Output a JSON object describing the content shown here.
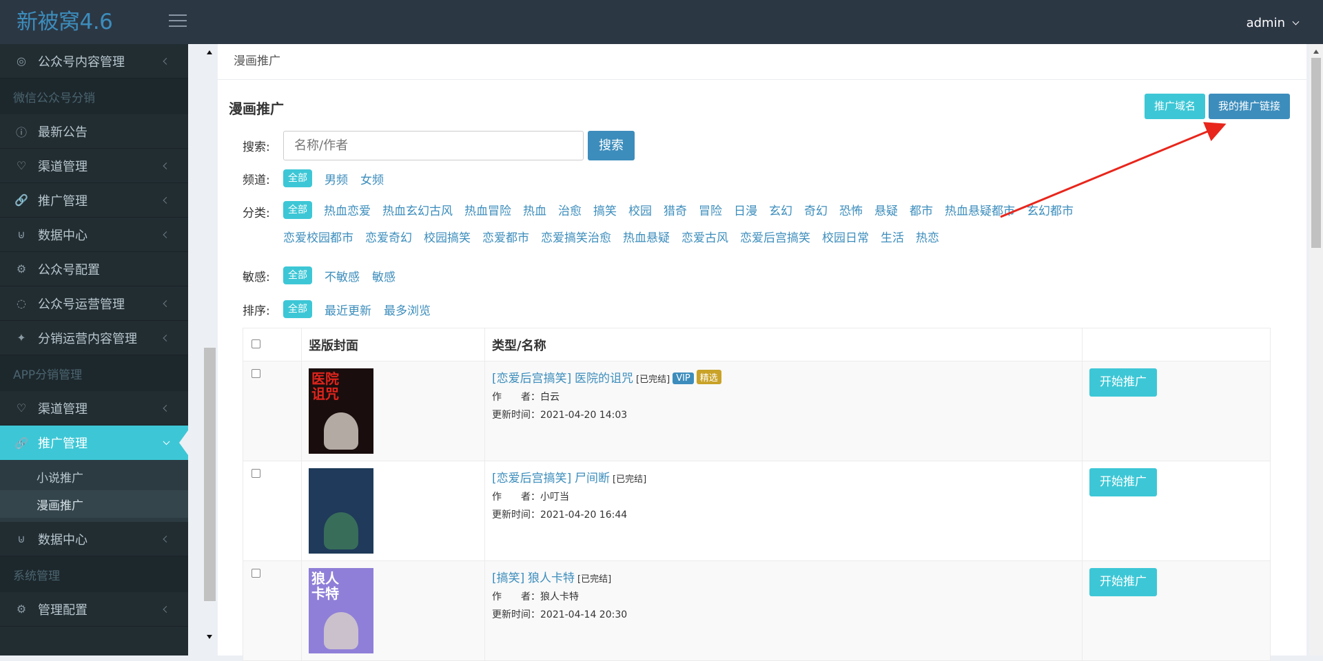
{
  "app": {
    "logo": "新被窝4.6",
    "user": "admin"
  },
  "sidebar": {
    "items": [
      {
        "label": "公众号内容管理",
        "icon": "compass-icon",
        "type": "item"
      },
      {
        "label": "微信公众号分销",
        "type": "header"
      },
      {
        "label": "最新公告",
        "icon": "info-icon",
        "type": "item"
      },
      {
        "label": "渠道管理",
        "icon": "lightbulb-icon",
        "type": "item"
      },
      {
        "label": "推广管理",
        "icon": "link-icon",
        "type": "item"
      },
      {
        "label": "数据中心",
        "icon": "cart-icon",
        "type": "item"
      },
      {
        "label": "公众号配置",
        "icon": "gear-icon",
        "type": "item"
      },
      {
        "label": "公众号运营管理",
        "icon": "chat-icon",
        "type": "item"
      },
      {
        "label": "分销运营内容管理",
        "icon": "puzzle-icon",
        "type": "item"
      },
      {
        "label": "APP分销管理",
        "type": "header"
      },
      {
        "label": "渠道管理",
        "icon": "lightbulb-icon",
        "type": "item"
      },
      {
        "label": "推广管理",
        "icon": "link-icon",
        "type": "active"
      },
      {
        "label": "数据中心",
        "icon": "cart-icon",
        "type": "item"
      },
      {
        "label": "系统管理",
        "type": "header"
      },
      {
        "label": "管理配置",
        "icon": "gear-icon",
        "type": "item"
      }
    ],
    "sub_items": [
      "小说推广",
      "漫画推广"
    ]
  },
  "breadcrumb": "漫画推广",
  "box": {
    "title": "漫画推广",
    "btn_domain": "推广域名",
    "btn_mylink": "我的推广链接"
  },
  "filters": {
    "search_label": "搜索:",
    "search_placeholder": "名称/作者",
    "search_button": "搜索",
    "channel_label": "频道:",
    "channel": [
      "全部",
      "男频",
      "女频"
    ],
    "category_label": "分类:",
    "category": [
      "全部",
      "热血恋爱",
      "热血玄幻古风",
      "热血冒险",
      "热血",
      "治愈",
      "搞笑",
      "校园",
      "猎奇",
      "冒险",
      "日漫",
      "玄幻",
      "奇幻",
      "恐怖",
      "悬疑",
      "都市",
      "热血悬疑都市",
      "玄幻都市",
      "恋爱校园都市",
      "恋爱奇幻",
      "校园搞笑",
      "恋爱都市",
      "恋爱搞笑治愈",
      "热血悬疑",
      "恋爱古风",
      "恋爱后宫搞笑",
      "校园日常",
      "生活",
      "热恋"
    ],
    "sensitive_label": "敏感:",
    "sensitive": [
      "全部",
      "不敏感",
      "敏感"
    ],
    "sort_label": "排序:",
    "sort": [
      "全部",
      "最近更新",
      "最多浏览"
    ]
  },
  "table": {
    "headers": [
      "竖版封面",
      "类型/名称"
    ],
    "rows": [
      {
        "type": "[恋爱后宫搞笑]",
        "name": "医院的诅咒",
        "status": "[已完结]",
        "vip": "VIP",
        "featured": "精选",
        "author_label": "作　　者：",
        "author": "白云",
        "update_label": "更新时间：",
        "updated": "2021-04-20 14:03",
        "action": "开始推广",
        "cover_text": "医院诅咒",
        "cover_bg": "#1a0d0d"
      },
      {
        "type": "[恋爱后宫搞笑]",
        "name": "尸间断",
        "status": "[已完结]",
        "vip": "",
        "featured": "",
        "author_label": "作　　者：",
        "author": "小叮当",
        "update_label": "更新时间：",
        "updated": "2021-04-20 16:44",
        "action": "开始推广",
        "cover_text": "",
        "cover_bg": "#1f3a5a"
      },
      {
        "type": "[搞笑]",
        "name": "狼人卡特",
        "status": "[已完结]",
        "vip": "",
        "featured": "",
        "author_label": "作　　者：",
        "author": "狼人卡特",
        "update_label": "更新时间：",
        "updated": "2021-04-14 20:30",
        "action": "开始推广",
        "cover_text": "狼人卡特",
        "cover_bg": "#8f7fd8"
      }
    ]
  },
  "colors": {
    "accent": "#3dc7d6",
    "primary": "#3c8dbc",
    "sidebar": "#222d32",
    "annotation_arrow": "#e8261c"
  }
}
